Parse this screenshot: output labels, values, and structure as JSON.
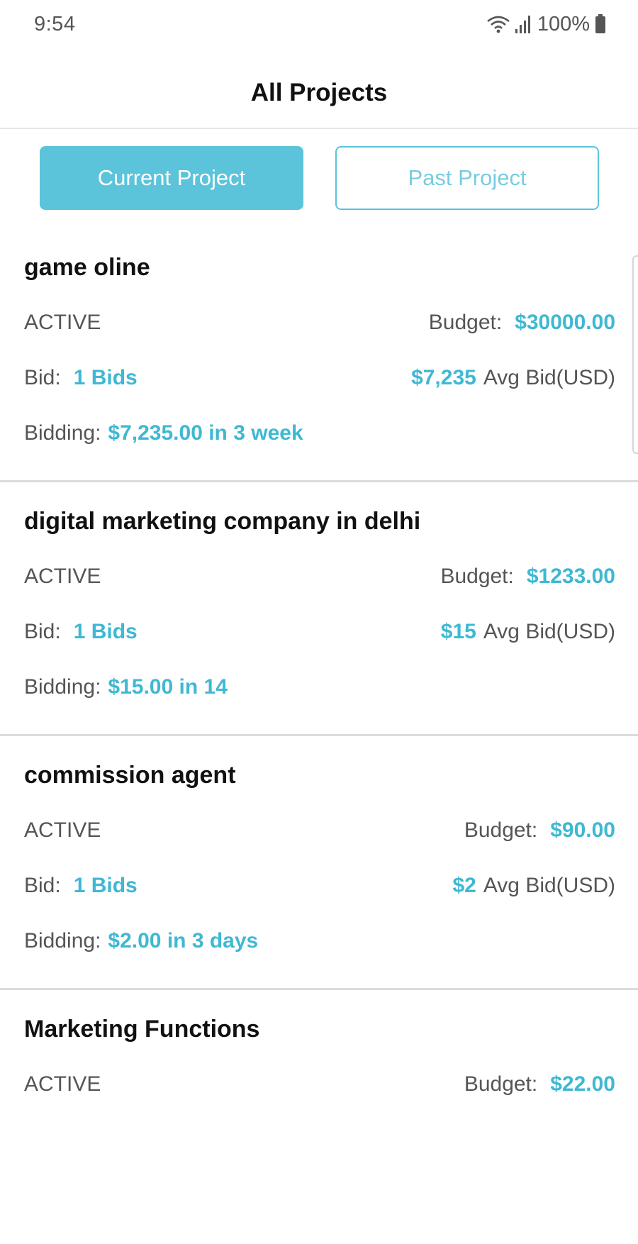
{
  "status_bar": {
    "time": "9:54",
    "battery": "100%",
    "icons": [
      "wifi-icon",
      "signal-icon",
      "battery-icon"
    ]
  },
  "header": {
    "title": "All Projects"
  },
  "tabs": {
    "current_label": "Current Project",
    "past_label": "Past Project",
    "selected": "Current Project"
  },
  "colors": {
    "accent": "#5bc4da",
    "accent_text": "#3fb8d3"
  },
  "projects": [
    {
      "title": "game oline",
      "status": "ACTIVE",
      "budget_label": "Budget:",
      "budget": "$30000.00",
      "bid_label": "Bid:",
      "bids": "1 Bids",
      "avg_bid": "$7,235",
      "avg_bid_label": "Avg Bid(USD)",
      "bidding_label": "Bidding:",
      "bidding": "$7,235.00 in 3 week"
    },
    {
      "title": "digital marketing company in delhi",
      "status": "ACTIVE",
      "budget_label": "Budget:",
      "budget": "$1233.00",
      "bid_label": "Bid:",
      "bids": "1 Bids",
      "avg_bid": "$15",
      "avg_bid_label": "Avg Bid(USD)",
      "bidding_label": "Bidding:",
      "bidding": "$15.00 in 14"
    },
    {
      "title": "commission agent",
      "status": "ACTIVE",
      "budget_label": "Budget:",
      "budget": "$90.00",
      "bid_label": "Bid:",
      "bids": "1 Bids",
      "avg_bid": "$2",
      "avg_bid_label": "Avg Bid(USD)",
      "bidding_label": "Bidding:",
      "bidding": "$2.00 in 3 days"
    },
    {
      "title": "Marketing Functions",
      "status": "ACTIVE",
      "budget_label": "Budget:",
      "budget": "$22.00"
    }
  ]
}
